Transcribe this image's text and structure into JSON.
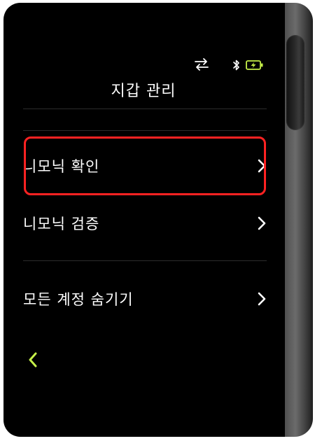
{
  "header": {
    "title": "지갑 관리"
  },
  "status_bar": {
    "icons": [
      "transfer-arrows-icon",
      "bluetooth-icon",
      "battery-charging-icon"
    ],
    "battery_color": "#c6f049"
  },
  "menu": {
    "items": [
      {
        "label": "니모닉 확인",
        "icon": "chevron-right-icon"
      },
      {
        "label": "니모닉 검증",
        "icon": "chevron-right-icon"
      },
      {
        "label": "모든 계정 숨기기",
        "icon": "chevron-right-icon"
      }
    ]
  },
  "annotation": {
    "highlight_color": "#ff2222"
  },
  "footer": {
    "back_icon": "chevron-left-icon",
    "back_color": "#c6f049"
  }
}
